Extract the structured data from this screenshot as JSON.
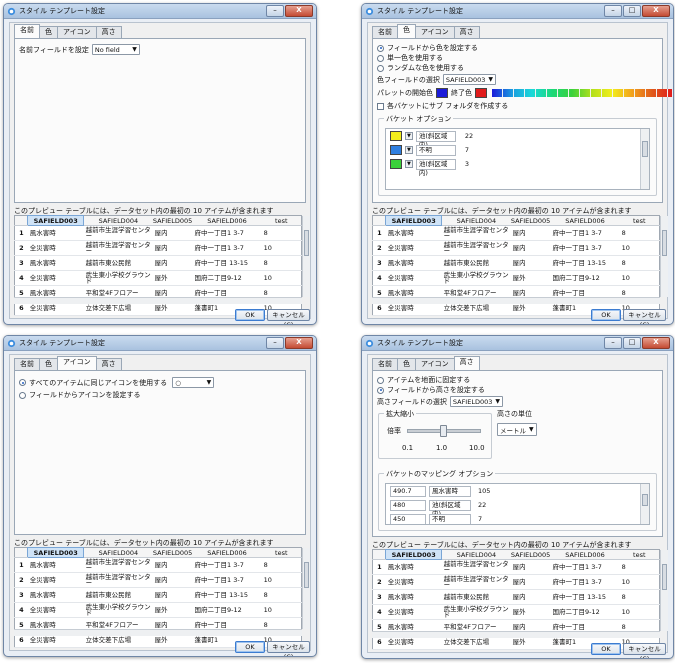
{
  "title": "スタイル テンプレート設定",
  "window_buttons": {
    "minimize": "–",
    "maximize": "□",
    "close": "X"
  },
  "tabs": [
    "名前",
    "色",
    "アイコン",
    "高さ"
  ],
  "name_tab": {
    "label": "名前フィールドを設定",
    "field_value": "No field"
  },
  "color_tab": {
    "radio_field": "フィールドから色を設定する",
    "radio_single": "単一色を使用する",
    "radio_random": "ランダムな色を使用する",
    "field_select_label": "色フィールドの選択",
    "field_select_value": "SAFIELD003",
    "palette_start_label": "パレットの開始色",
    "palette_end_label": "終了色",
    "start_color": "#1b1bd9",
    "end_color": "#e01b1b",
    "subfolder_label": "各バケットにサブ フォルダを作成する",
    "bucket_group_title": "バケット オプション",
    "buckets": [
      {
        "color": "#f2ee1c",
        "label": "池(斜区域内)",
        "count": "22"
      },
      {
        "color": "#2f7fe0",
        "label": "不明",
        "count": "7"
      },
      {
        "color": "#3bd13b",
        "label": "池(斜区域内)",
        "count": "3"
      }
    ]
  },
  "icon_tab": {
    "radio_all": "すべてのアイテムに同じアイコンを使用する",
    "radio_field": "フィールドからアイコンを設定する",
    "icon_select_value": "○"
  },
  "height_tab": {
    "radio_ground": "アイテムを地面に固定する",
    "radio_field": "フィールドから高さを設定する",
    "height_field_label": "高さフィールドの選択",
    "height_field_value": "SAFIELD003",
    "scale_group_title": "拡大縮小",
    "scale_label": "倍率",
    "scale_ticks": [
      "0.1",
      "1.0",
      "10.0"
    ],
    "scale_value": 1.0,
    "unit_group_title": "高さの単位",
    "unit_value": "メートル",
    "bucket_group_title": "バケットのマッピング オプション",
    "buckets": [
      {
        "height": "490.7",
        "label": "風水害時",
        "count": "105"
      },
      {
        "height": "480",
        "label": "池(斜区域内)",
        "count": "22"
      },
      {
        "height": "450",
        "label": "不明",
        "count": "7"
      }
    ]
  },
  "preview": {
    "caption": "このプレビュー テーブルには、データセット内の最初の 10 アイテムが含まれます",
    "columns": [
      "SAFIELD003",
      "SAFIELD004",
      "SAFIELD005",
      "SAFIELD006",
      "test"
    ],
    "rows": [
      [
        "1",
        "風水害時",
        "越前市生涯学習センター",
        "屋内",
        "府中一丁目1 3-7",
        "8"
      ],
      [
        "2",
        "全災害時",
        "越前市生涯学習センター",
        "屋内",
        "府中一丁目1 3-7",
        "10"
      ],
      [
        "3",
        "風水害時",
        "越前市東公民館",
        "屋内",
        "府中一丁目 13-15",
        "8"
      ],
      [
        "4",
        "全災害時",
        "武生東小学校グラウンド",
        "屋外",
        "国府二丁目9-12",
        "10"
      ],
      [
        "5",
        "風水害時",
        "平和堂4Fフロアー",
        "屋内",
        "府中一丁目",
        "8"
      ],
      [
        "6",
        "全災害時",
        "立体交差下広場",
        "屋外",
        "蓬書町1",
        "10"
      ]
    ]
  },
  "buttons": {
    "ok": "OK",
    "cancel": "キャンセル(C)"
  }
}
